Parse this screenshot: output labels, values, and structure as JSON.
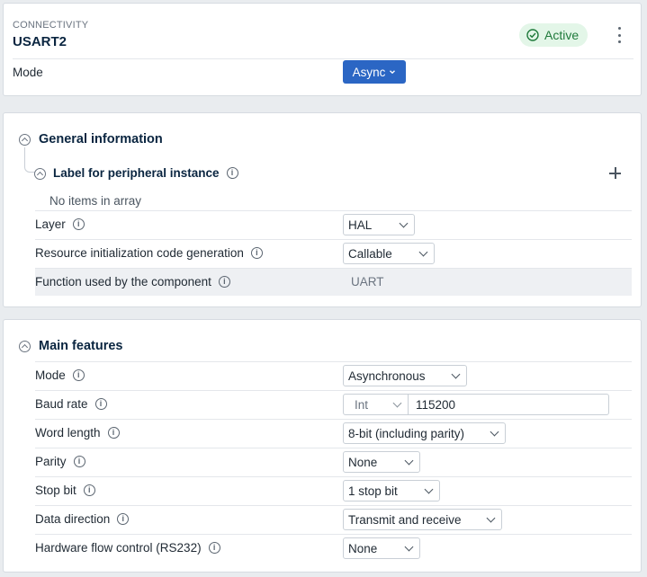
{
  "header": {
    "category": "CONNECTIVITY",
    "peripheral": "USART2",
    "status": "Active",
    "mode_label": "Mode",
    "mode_value": "Async"
  },
  "general": {
    "title": "General information",
    "label_section": "Label for peripheral instance",
    "empty_text": "No items in array",
    "rows": [
      {
        "label": "Layer",
        "value": "HAL",
        "type": "select"
      },
      {
        "label": "Resource initialization code generation",
        "value": "Callable",
        "type": "select"
      },
      {
        "label": "Function used by the component",
        "value": "UART",
        "type": "readonly"
      }
    ]
  },
  "main": {
    "title": "Main features",
    "rows": [
      {
        "label": "Mode",
        "value": "Asynchronous",
        "type": "select"
      },
      {
        "label": "Baud rate",
        "value_type": "Int",
        "value": "115200",
        "type": "number"
      },
      {
        "label": "Word length",
        "value": "8-bit (including parity)",
        "type": "select"
      },
      {
        "label": "Parity",
        "value": "None",
        "type": "select"
      },
      {
        "label": "Stop bit",
        "value": "1 stop bit",
        "type": "select"
      },
      {
        "label": "Data direction",
        "value": "Transmit and receive",
        "type": "select"
      },
      {
        "label": "Hardware flow control (RS232)",
        "value": "None",
        "type": "select"
      }
    ]
  },
  "colors": {
    "accent": "#2b66c4",
    "active_bg": "#e3f6e8",
    "active_text": "#1f7a3b"
  },
  "icons": {
    "info": "info-icon",
    "collapse": "collapse-icon",
    "add": "plus-icon",
    "more": "kebab-icon",
    "status": "check-circle-icon"
  }
}
